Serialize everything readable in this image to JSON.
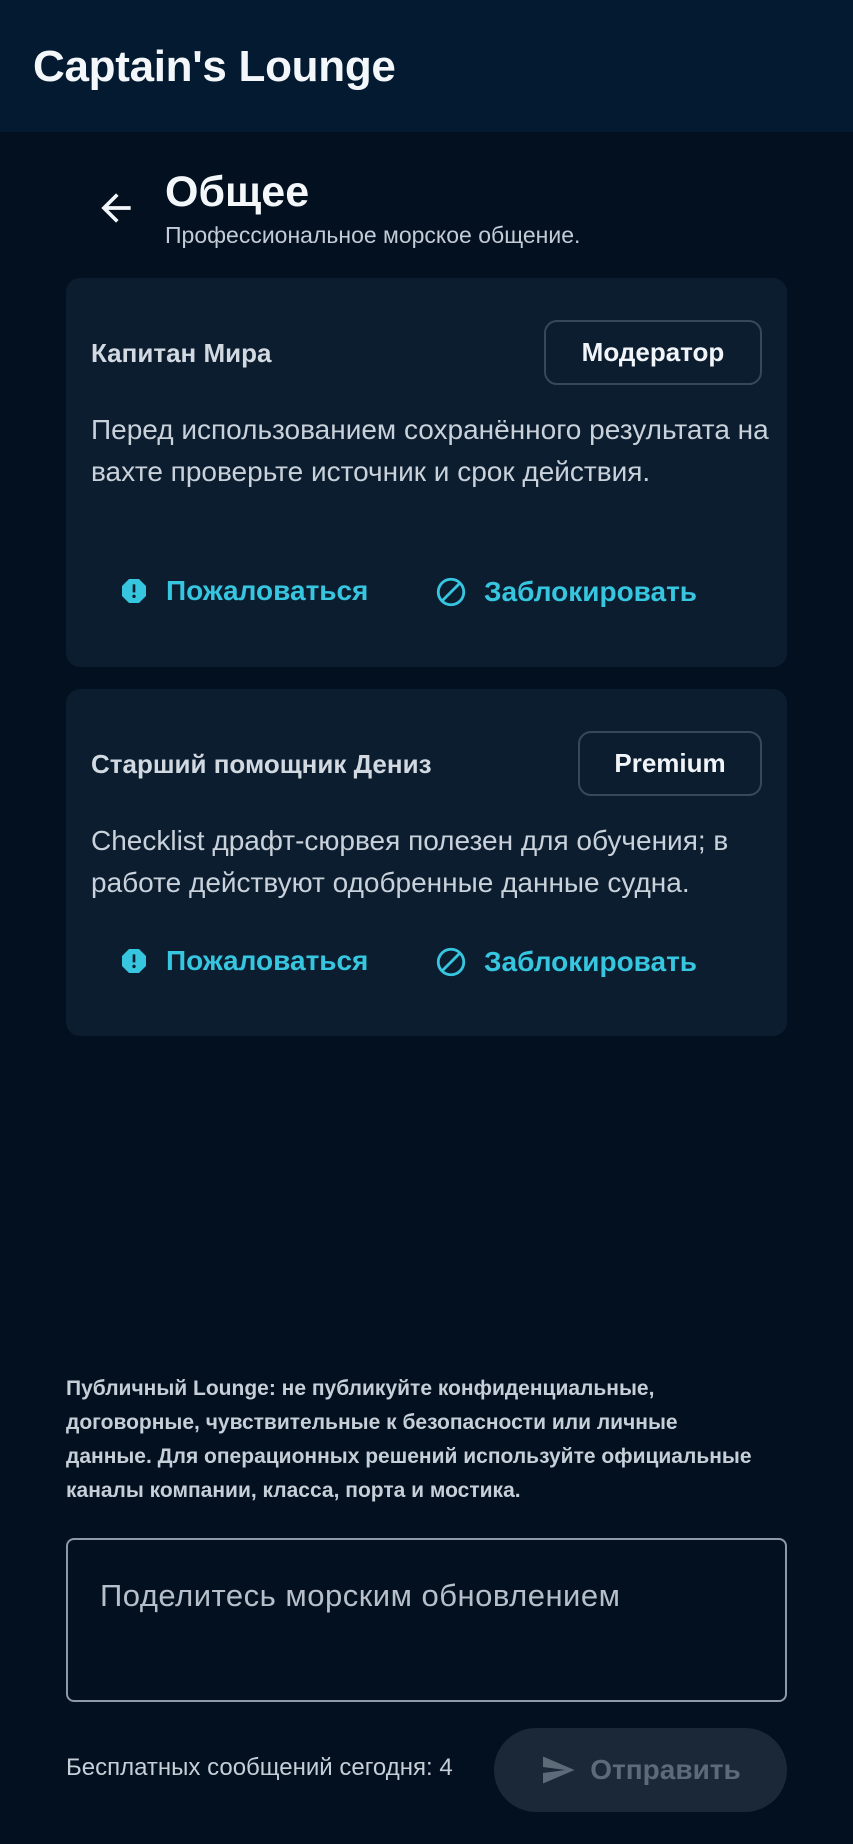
{
  "app": {
    "title": "Captain's Lounge"
  },
  "header": {
    "title": "Общее",
    "subtitle": "Профессиональное морское общение."
  },
  "posts": [
    {
      "author": "Капитан Мира",
      "badge": "Модератор",
      "text": "Перед использованием сохранённого результата на вахте проверьте источник и срок действия.",
      "report_label": "Пожаловаться",
      "block_label": "Заблокировать"
    },
    {
      "author": "Старший помощник Дениз",
      "badge": "Premium",
      "text": "Checklist драфт-сюрвея полезен для обучения; в работе действуют одобренные данные судна.",
      "report_label": "Пожаловаться",
      "block_label": "Заблокировать"
    }
  ],
  "disclaimer": "Публичный Lounge: не публикуйте конфиденциальные, договорные, чувствительные к безопасности или личные данные. Для операционных решений используйте официальные каналы компании, класса, порта и мостика.",
  "composer": {
    "placeholder": "Поделитесь морским обновлением"
  },
  "footer": {
    "quota_text": "Бесплатных сообщений сегодня: 4",
    "send_label": "Отправить"
  },
  "colors": {
    "background": "#02101f",
    "appbar": "#031a31",
    "card": "#0c1d2f",
    "accent": "#36c6e0",
    "send_disabled_bg": "#1a2838"
  },
  "icons": {
    "back": "arrow-left-icon",
    "report": "alert-octagon-icon",
    "block": "block-icon",
    "send": "send-icon"
  }
}
